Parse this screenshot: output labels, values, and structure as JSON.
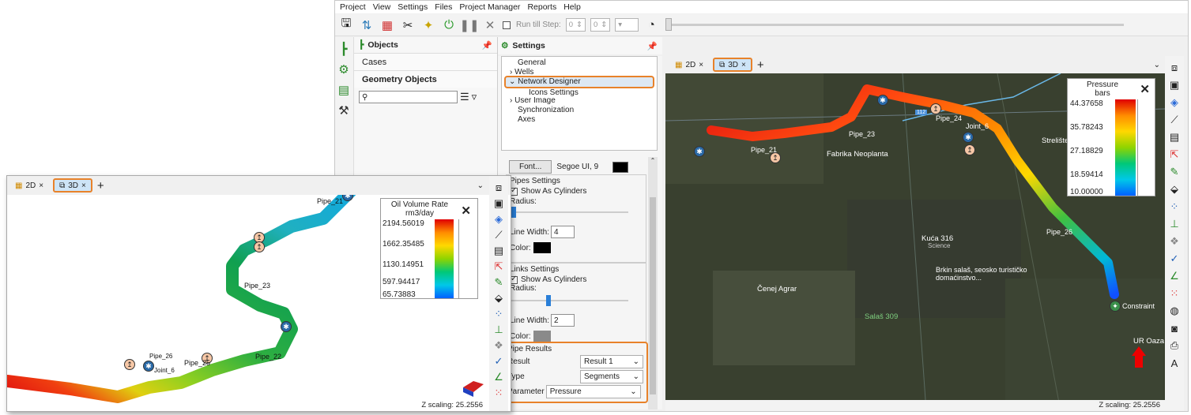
{
  "menu": [
    "Project",
    "View",
    "Settings",
    "Files",
    "Project Manager",
    "Reports",
    "Help"
  ],
  "toolbar": {
    "run_till_step_label": "Run till Step:",
    "step_from": "0",
    "step_to": "0"
  },
  "objects_panel": {
    "title": "Objects",
    "cases": "Cases",
    "geometry_objects": "Geometry Objects"
  },
  "settings_panel": {
    "title": "Settings",
    "tree": [
      "General",
      "Wells",
      "Network Designer",
      "Icons Settings",
      "User Image",
      "Synchronization",
      "Axes"
    ],
    "font_button": "Font...",
    "font_value": "Segoe UI, 9",
    "pipes_settings": "Pipes Settings",
    "show_as_cylinders": "Show As Cylinders",
    "radius": "Radius:",
    "line_width": "Line Width:",
    "pipes_line_width": "4",
    "color": "Color:",
    "links_settings": "Links Settings",
    "links_line_width": "2",
    "pipe_results": "Pipe Results",
    "result_label": "Result",
    "result_value": "Result 1",
    "type_label": "Type",
    "type_value": "Segments",
    "parameter_label": "Parameter",
    "parameter_value": "Pressure"
  },
  "view_tabs": {
    "tab_2d": "2D",
    "tab_3d": "3D"
  },
  "main_view": {
    "legend_title": "Pressure",
    "legend_unit": "bars",
    "legend_values": [
      "44.37658",
      "35.78243",
      "27.18829",
      "18.59414",
      "10.00000"
    ],
    "z_scaling": "Z scaling: 25.2556",
    "pipes": [
      "Pipe_21",
      "Pipe_23",
      "Pipe_24",
      "Pipe_26"
    ],
    "joint": "Joint_6",
    "constraint": "Constraint",
    "places": [
      "Fabrika Neoplanta",
      "Kuća 316",
      "Science",
      "Čenej Agrar",
      "Salaš 309",
      "Brkin salaš, seosko turističko domaćinstvo...",
      "UR Oaza",
      "Strelište"
    ],
    "road": "112"
  },
  "inset_view": {
    "legend_title": "Oil Volume Rate",
    "legend_unit": "rm3/day",
    "legend_values": [
      "2194.56019",
      "1662.35485",
      "1130.14951",
      "597.94417",
      "65.73883"
    ],
    "z_scaling": "Z scaling: 25.2556",
    "pipes": [
      "Pipe_21",
      "Pipe_23",
      "Pipe_22",
      "Pipe_25",
      "Pipe_26"
    ],
    "joint": "Joint_6"
  },
  "colors": {
    "accent": "#e8822a",
    "tab_active": "#cde4f7"
  }
}
